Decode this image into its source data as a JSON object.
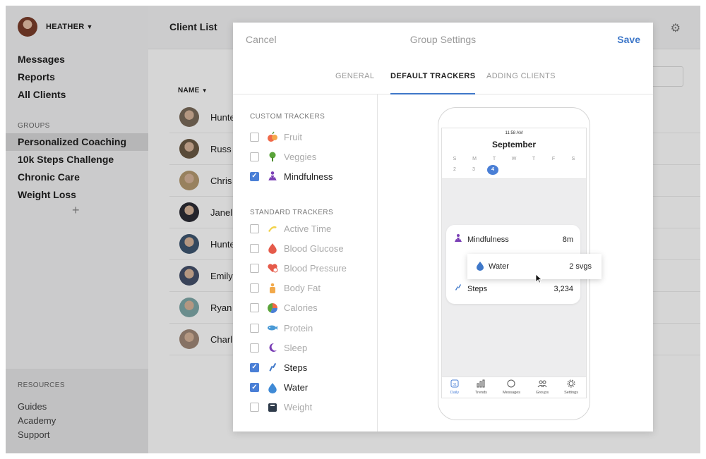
{
  "sidebar": {
    "user_name": "HEATHER",
    "nav": [
      "Messages",
      "Reports",
      "All Clients"
    ],
    "groups_title": "GROUPS",
    "groups": [
      "Personalized Coaching",
      "10k Steps Challenge",
      "Chronic Care",
      "Weight Loss"
    ],
    "add_group": "+",
    "resources_title": "RESOURCES",
    "resources": [
      "Guides",
      "Academy",
      "Support"
    ]
  },
  "main": {
    "title": "Client List",
    "name_column": "NAME",
    "clients": [
      {
        "name": "Hunte",
        "color": "#7a6a5a"
      },
      {
        "name": "Russ C",
        "color": "#6b5a44"
      },
      {
        "name": "Chris",
        "color": "#b59a70"
      },
      {
        "name": "Janell",
        "color": "#2c2c34"
      },
      {
        "name": "Hunte",
        "color": "#3e5670"
      },
      {
        "name": "Emily",
        "color": "#45506a"
      },
      {
        "name": "Ryan V",
        "color": "#7fa8a8"
      },
      {
        "name": "Charli",
        "color": "#a08878"
      }
    ]
  },
  "modal": {
    "cancel": "Cancel",
    "title": "Group Settings",
    "save": "Save",
    "tabs": [
      "GENERAL",
      "DEFAULT TRACKERS",
      "ADDING CLIENTS"
    ],
    "custom_title": "CUSTOM TRACKERS",
    "custom": [
      {
        "label": "Fruit",
        "checked": false,
        "icon": "fruit-icon"
      },
      {
        "label": "Veggies",
        "checked": false,
        "icon": "veggies-icon"
      },
      {
        "label": "Mindfulness",
        "checked": true,
        "icon": "mindfulness-icon"
      }
    ],
    "standard_title": "STANDARD TRACKERS",
    "standard": [
      {
        "label": "Active Time",
        "checked": false,
        "icon": "active-time-icon"
      },
      {
        "label": "Blood Glucose",
        "checked": false,
        "icon": "blood-glucose-icon"
      },
      {
        "label": "Blood Pressure",
        "checked": false,
        "icon": "blood-pressure-icon"
      },
      {
        "label": "Body Fat",
        "checked": false,
        "icon": "body-fat-icon"
      },
      {
        "label": "Calories",
        "checked": false,
        "icon": "calories-icon"
      },
      {
        "label": "Protein",
        "checked": false,
        "icon": "protein-icon"
      },
      {
        "label": "Sleep",
        "checked": false,
        "icon": "sleep-icon"
      },
      {
        "label": "Steps",
        "checked": true,
        "icon": "steps-icon"
      },
      {
        "label": "Water",
        "checked": true,
        "icon": "water-icon"
      },
      {
        "label": "Weight",
        "checked": false,
        "icon": "weight-icon"
      }
    ]
  },
  "phone": {
    "time": "11:58 AM",
    "month": "September",
    "days": [
      "S",
      "M",
      "T",
      "W",
      "T",
      "F",
      "S"
    ],
    "dates": [
      "2",
      "3",
      "4"
    ],
    "selected_date": "4",
    "mindfulness": {
      "label": "Mindfulness",
      "value": "8m"
    },
    "water": {
      "label": "Water",
      "value": "2 svgs"
    },
    "steps": {
      "label": "Steps",
      "value": "3,234"
    },
    "tabbar": [
      "Daily",
      "Trends",
      "Messages",
      "Groups",
      "Settings"
    ],
    "daily_badge": "31"
  },
  "colors": {
    "accent": "#4a7fd6",
    "save": "#3f78c9"
  }
}
